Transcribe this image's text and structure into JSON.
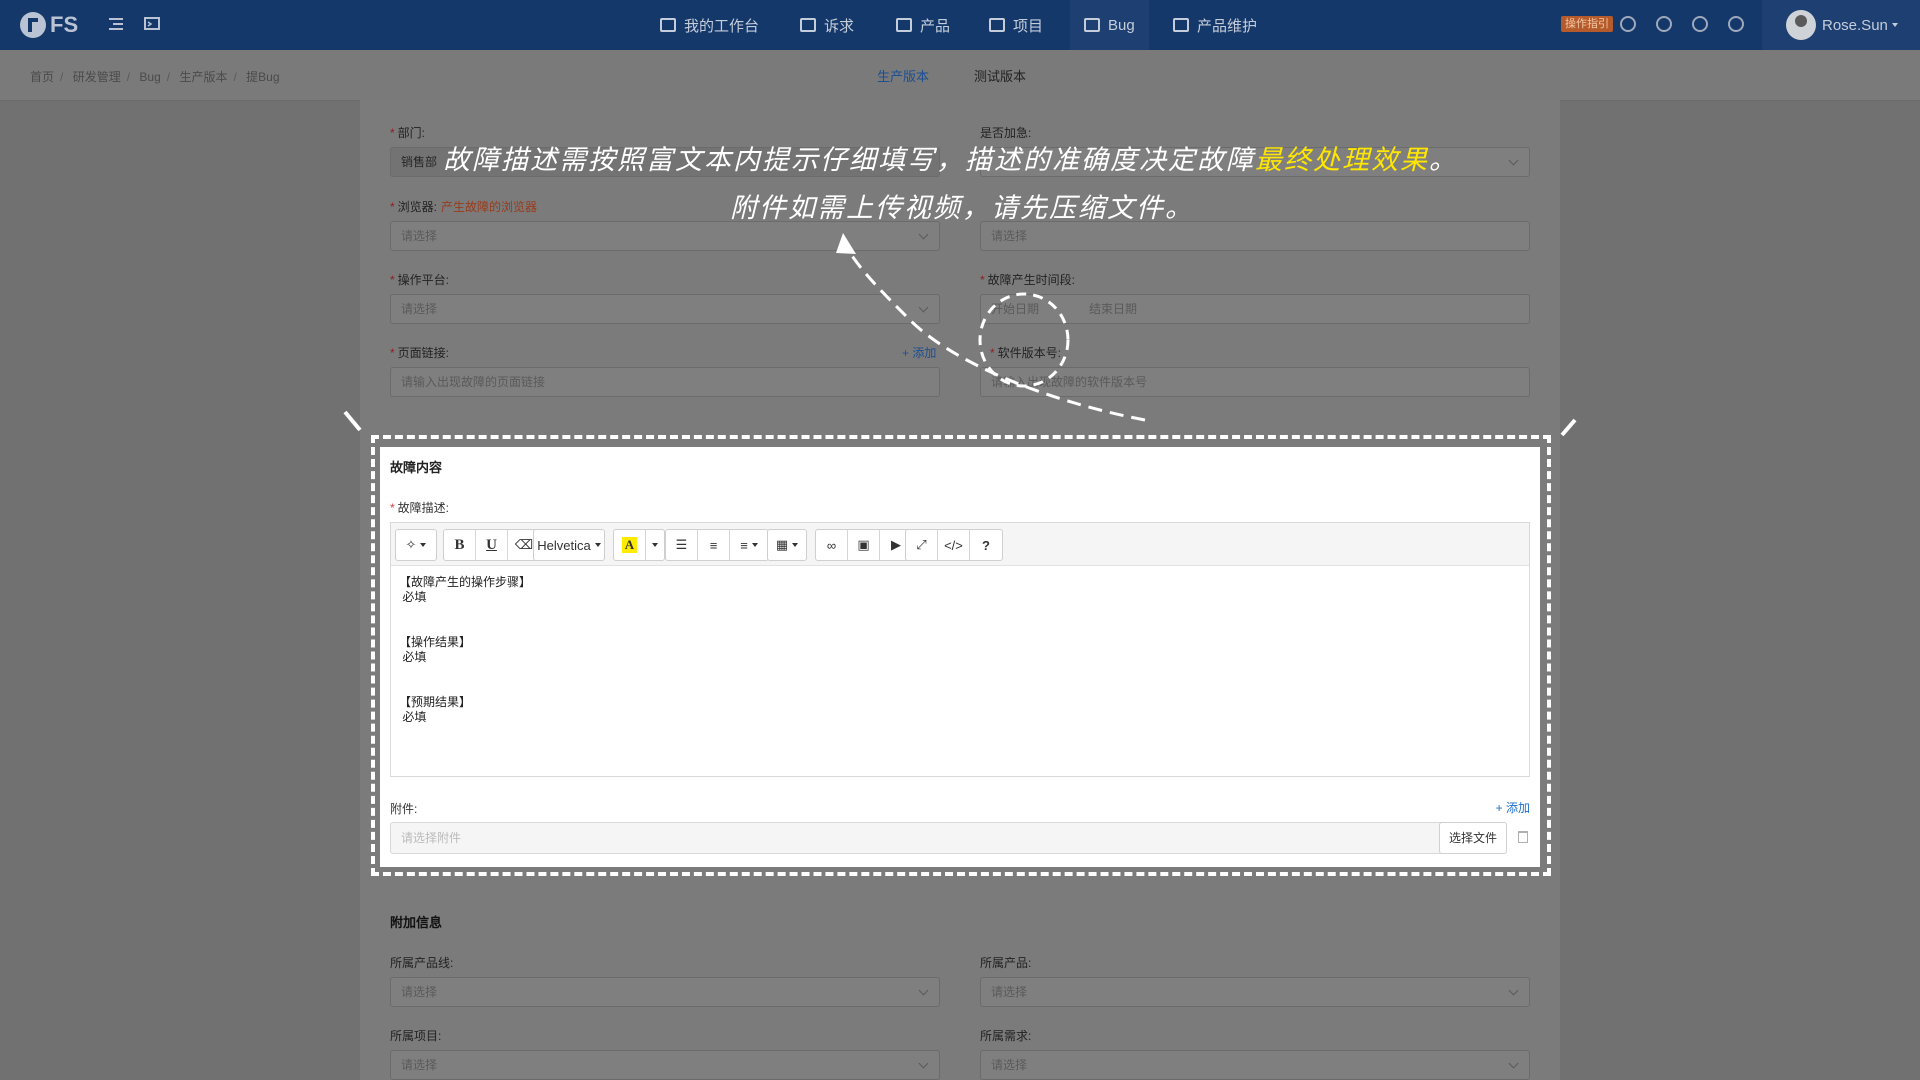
{
  "nav": {
    "logo_text": "FS",
    "items": [
      "我的工作台",
      "诉求",
      "产品",
      "项目",
      "Bug",
      "产品维护"
    ],
    "active_item": "Bug",
    "guide_label": "操作指引",
    "username": "Rose.Sun"
  },
  "breadcrumb": [
    "首页",
    "研发管理",
    "Bug",
    "生产版本",
    "提Bug"
  ],
  "version_tabs": [
    "生产版本",
    "测试版本"
  ],
  "form": {
    "dept_label": "部门:",
    "dept_value": "销售部",
    "urgent_label": "是否加急:",
    "browser_label": "浏览器:",
    "browser_hint": "产生故障的浏览器",
    "browser_placeholder": "请选择",
    "right2_placeholder": "请选择",
    "platform_label": "操作平台:",
    "platform_placeholder": "请选择",
    "period_label": "故障产生时间段:",
    "period_start": "开始日期",
    "period_end": "结束日期",
    "link_label": "页面链接:",
    "link_add": "+ 添加",
    "link_placeholder": "请输入出现故障的页面链接",
    "sw_label": "软件版本号:",
    "sw_placeholder": "请输入出现故障的软件版本号"
  },
  "panel": {
    "title": "故障内容",
    "desc_label": "故障描述:",
    "font_name": "Helvetica",
    "color_btn": "A",
    "content_lines": [
      "【故障产生的操作步骤】",
      " 必填",
      "",
      "",
      "【操作结果】",
      " 必填",
      "",
      "",
      "【预期结果】",
      " 必填"
    ],
    "attach_label": "附件:",
    "attach_add": "+ 添加",
    "attach_placeholder": "请选择附件",
    "choose_file": "选择文件"
  },
  "extra": {
    "title": "附加信息",
    "product_line_label": "所属产品线:",
    "product_label": "所属产品:",
    "project_label": "所属项目:",
    "demand_label": "所属需求:",
    "placeholder": "请选择"
  },
  "annotation": {
    "line1_a": "故障描述需按照富文本内提示仔细填写，描述的准确度决定故障",
    "line1_b": "最终处理效果",
    "line1_c": "。",
    "line2": "附件如需上传视频，请先压缩文件。"
  },
  "colors": {
    "nav_bg": "#15386a",
    "accent": "#1d6fd1",
    "highlight": "#ffe600",
    "required": "#e23b3b"
  }
}
